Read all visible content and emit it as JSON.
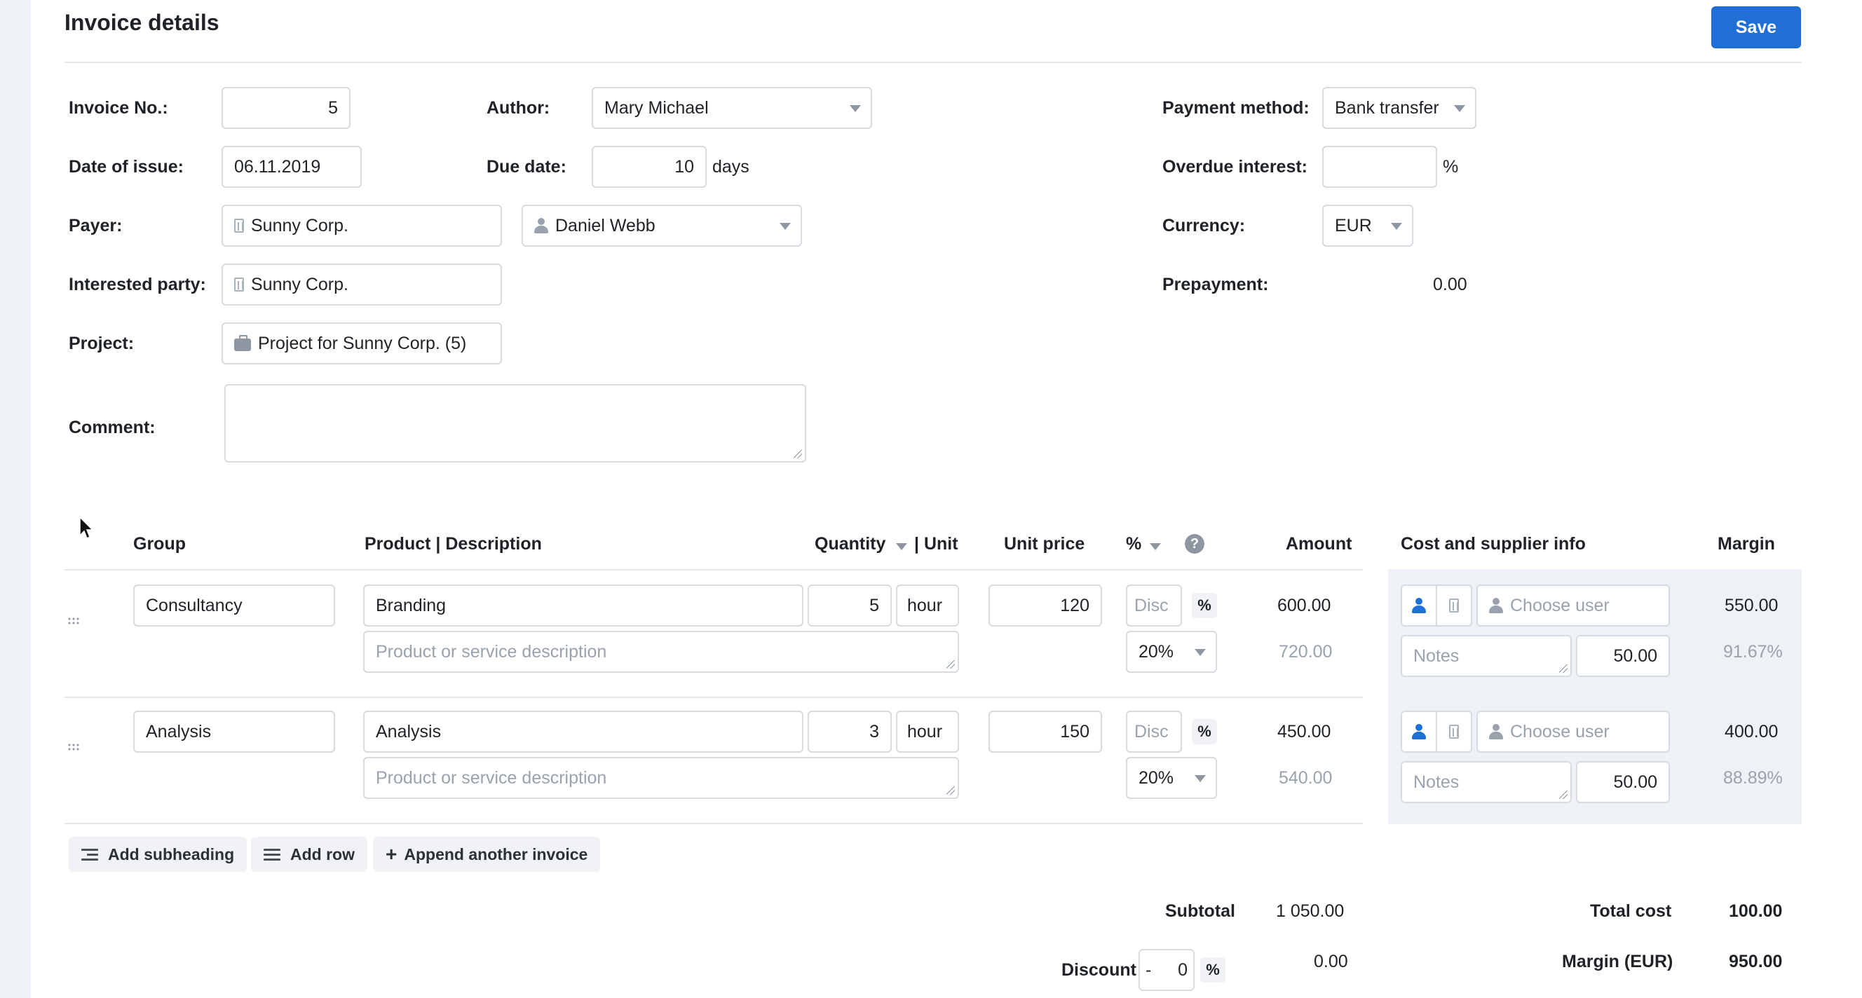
{
  "header": {
    "title": "Invoice details",
    "save_label": "Save"
  },
  "form": {
    "invoice_no_label": "Invoice No.:",
    "invoice_no": "5",
    "author_label": "Author:",
    "author": "Mary Michael",
    "payment_method_label": "Payment method:",
    "payment_method": "Bank transfer",
    "date_of_issue_label": "Date of issue:",
    "date_of_issue": "06.11.2019",
    "due_date_label": "Due date:",
    "due_date": "10",
    "due_unit": "days",
    "overdue_interest_label": "Overdue interest:",
    "overdue_interest": "",
    "overdue_unit": "%",
    "payer_label": "Payer:",
    "payer_company": "Sunny Corp.",
    "payer_person": "Daniel Webb",
    "currency_label": "Currency:",
    "currency": "EUR",
    "interested_party_label": "Interested party:",
    "interested_party": "Sunny Corp.",
    "prepayment_label": "Prepayment:",
    "prepayment": "0.00",
    "project_label": "Project:",
    "project": "Project for Sunny Corp. (5)",
    "comment_label": "Comment:",
    "comment": ""
  },
  "table": {
    "headers": {
      "group": "Group",
      "product": "Product | Description",
      "quantity": "Quantity",
      "unit": "| Unit",
      "unit_price": "Unit price",
      "percent": "%",
      "amount": "Amount",
      "cost_info": "Cost and supplier info",
      "margin": "Margin"
    },
    "rows": [
      {
        "group": "Consultancy",
        "product": "Branding",
        "description_placeholder": "Product or service description",
        "quantity": "5",
        "unit": "hour",
        "unit_price": "120",
        "discount_placeholder": "Disc",
        "pct": "%",
        "vat": "20%",
        "amount": "600.00",
        "amount_with_vat": "720.00",
        "user_placeholder": "Choose user",
        "notes_placeholder": "Notes",
        "cost": "50.00",
        "margin": "550.00",
        "margin_pct": "91.67%"
      },
      {
        "group": "Analysis",
        "product": "Analysis",
        "description_placeholder": "Product or service description",
        "quantity": "3",
        "unit": "hour",
        "unit_price": "150",
        "discount_placeholder": "Disc",
        "pct": "%",
        "vat": "20%",
        "amount": "450.00",
        "amount_with_vat": "540.00",
        "user_placeholder": "Choose user",
        "notes_placeholder": "Notes",
        "cost": "50.00",
        "margin": "400.00",
        "margin_pct": "88.89%"
      }
    ]
  },
  "actions": {
    "add_subheading": "Add subheading",
    "add_row": "Add row",
    "append_invoice": "Append another invoice"
  },
  "totals": {
    "subtotal_label": "Subtotal",
    "subtotal": "1 050.00",
    "discount_label": "Discount",
    "discount_sign": "-",
    "discount_value": "0",
    "discount_pct": "%",
    "discount_amount": "0.00",
    "total_cost_label": "Total cost",
    "total_cost": "100.00",
    "margin_label": "Margin (EUR)",
    "margin": "950.00"
  }
}
